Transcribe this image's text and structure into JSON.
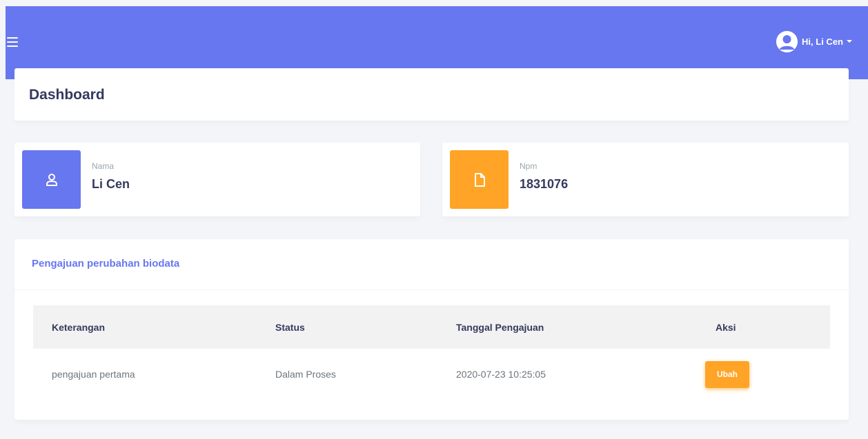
{
  "navbar": {
    "greeting": "Hi, Li Cen",
    "accent_color": "#6777ef"
  },
  "page": {
    "title": "Dashboard"
  },
  "stats": [
    {
      "label": "Nama",
      "value": "Li Cen",
      "icon": "user-icon",
      "color": "#6777ef"
    },
    {
      "label": "Npm",
      "value": "1831076",
      "icon": "file-icon",
      "color": "#ffa426"
    }
  ],
  "requests": {
    "title": "Pengajuan perubahan biodata",
    "columns": [
      "Keterangan",
      "Status",
      "Tanggal Pengajuan",
      "Aksi"
    ],
    "rows": [
      {
        "keterangan": "pengajuan pertama",
        "status": "Dalam Proses",
        "tanggal": "2020-07-23 10:25:05",
        "action_label": "Ubah"
      }
    ]
  }
}
